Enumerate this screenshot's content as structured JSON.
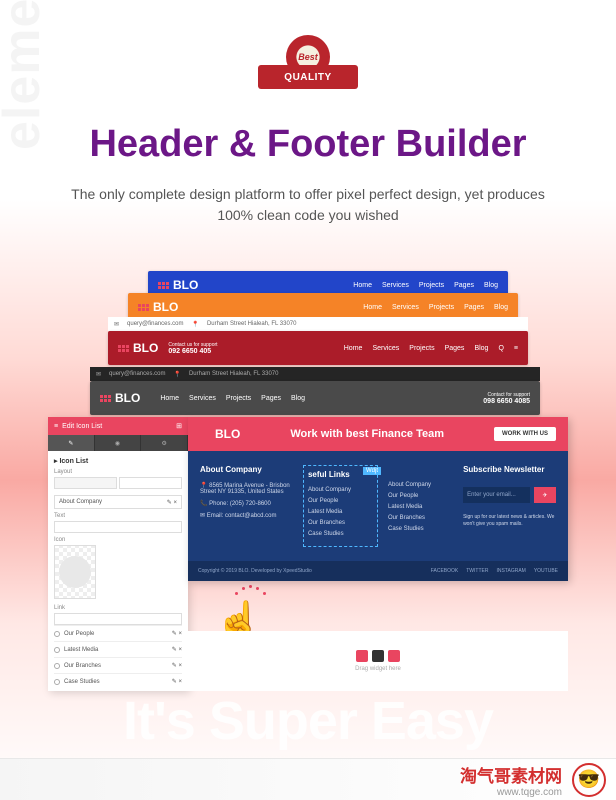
{
  "badge": {
    "top": "Best",
    "banner": "QUALITY"
  },
  "title": "Header & Footer Builder",
  "subtitle": "The only complete design platform to offer pixel perfect design, yet produces 100% clean code you wished",
  "watermark": "elementor",
  "headers": {
    "logo": "BLO",
    "nav_blue": [
      "Home",
      "Services",
      "Projects",
      "Pages",
      "Blog"
    ],
    "nav_orange": [
      "Home",
      "Services",
      "Projects",
      "Pages",
      "Blog"
    ],
    "red_top": {
      "email": "query@finances.com",
      "address": "Durham Street Hialeah, FL 33070"
    },
    "red": {
      "contact_label": "Contact us for support",
      "phone": "092 6650 405",
      "nav": [
        "Home",
        "Services",
        "Projects",
        "Pages",
        "Blog"
      ]
    },
    "dark_top": {
      "email": "query@finances.com",
      "address": "Durham Street Hialeah, FL 33070"
    },
    "dark": {
      "contact_label": "Contact for support",
      "phone": "098 6650 4085",
      "nav": [
        "Home",
        "Services",
        "Projects",
        "Pages",
        "Blog"
      ]
    }
  },
  "editor": {
    "header": "Edit Icon List",
    "tabs": [
      "Content",
      "Style",
      "Advanced"
    ],
    "section": "Icon List",
    "layout_label": "Layout",
    "item_label": "About Company",
    "text_label": "Text",
    "icon_label": "Icon",
    "link_label": "Link",
    "items": [
      "Our People",
      "Latest Media",
      "Our Branches",
      "Case Studies"
    ]
  },
  "footer": {
    "top_text": "Work with best Finance Team",
    "top_btn": "WORK WITH US",
    "cols": {
      "about": {
        "title": "About Company",
        "address": "8565 Marina Avenue - Brisbon Street NY 91335, United States",
        "phone": "Phone: (205) 720-8600",
        "email": "Email: contact@abcd.com"
      },
      "links1": {
        "title": "seful Links",
        "badge": "Wdjt",
        "items": [
          "About Company",
          "Our People",
          "Latest Media",
          "Our Branches",
          "Case Studies"
        ]
      },
      "links2_items": [
        "About Company",
        "Our People",
        "Latest Media",
        "Our Branches",
        "Case Studies"
      ],
      "subscribe": {
        "title": "Subscribe Newsletter",
        "placeholder": "Enter your email...",
        "note": "Sign up for our latest news & articles. We won't give you spam mails."
      }
    },
    "copyright": "Copyright © 2019 BLO. Developed by XpeedStudio",
    "social": [
      "FACEBOOK",
      "TWITTER",
      "INSTAGRAM",
      "YOUTUBE"
    ]
  },
  "drag_label": "Drag widget here",
  "super_easy": "It's Super Easy",
  "bottom": {
    "text": "淘气哥素材网",
    "url": "www.tqge.com"
  }
}
